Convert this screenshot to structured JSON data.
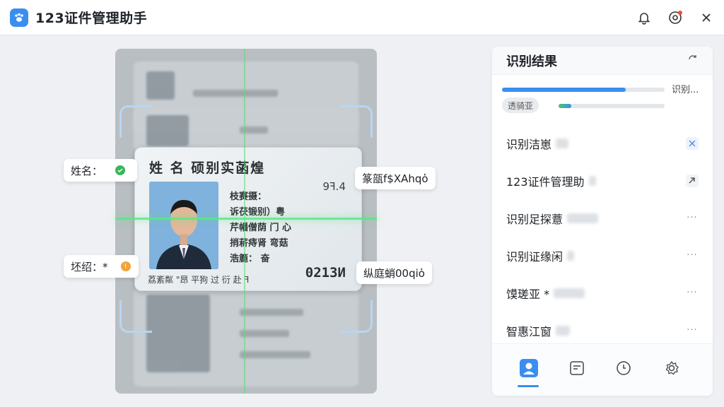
{
  "app": {
    "title": "123证件管理助手"
  },
  "card": {
    "title": "姓 名  硕别实菡煌",
    "top_number": "9ꟻ.4",
    "field1": "枝赛摄：",
    "field2": "诉茯锻别）粤",
    "field3": "芹幡僧荫 门 心",
    "field4": "捎菥痔肾 弯菇",
    "field5": "浩簏：  奋",
    "number": "0213И",
    "bottom": "荔紊粼 \"昂 平狗 过 衍 赴 ꟻ"
  },
  "tags": {
    "name_label": "姓名：",
    "right_top": "篆瓿f$XAhqὁ",
    "left_bottom": "坯绍：*",
    "right_bottom": "纵庭蛸00qiὁ"
  },
  "panel": {
    "title": "识别结果",
    "progress_label": "识别...",
    "status_pill": "透骑亚",
    "progress_main": 0.76,
    "progress_sub": 0.12,
    "rows": [
      {
        "label": "识别洁崽",
        "icon": "crop-icon"
      },
      {
        "label": "123证件管理助",
        "icon": "link-icon"
      },
      {
        "label": "识别足探薏",
        "icon": "more-icon",
        "more": "···"
      },
      {
        "label": "识别证缘闲",
        "icon": "more-icon",
        "more": "···"
      },
      {
        "label": "馍瑳亚 *",
        "icon": "more-icon",
        "more": "···"
      },
      {
        "label": "智惠江窗",
        "icon": "more-icon",
        "more": "···"
      }
    ]
  },
  "colors": {
    "accent": "#3a8ef0",
    "scan_line": "#5ae682",
    "alert_dot": "#ee4d3b"
  }
}
